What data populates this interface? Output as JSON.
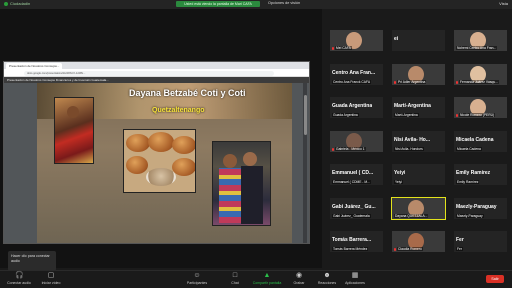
{
  "topbar": {
    "app_name": "Ciudadadin",
    "share_banner": "Usted está viendo la pantalla de Mari CAFA",
    "view_options": "Opciones de visión",
    "view_button": "Vista"
  },
  "browser": {
    "tab_title": "Presentación de Nosotros Concejos...",
    "url": "docs.google.com/presentation/d/e/2PACX-1vR8x...",
    "doc_title": "Presentación de Nosotros Consejos Financieros y de Inversión Guatemala..."
  },
  "slide": {
    "title": "Dayana Betzabé Coti y Coti",
    "city": "Quetzaltenango"
  },
  "popup": {
    "text": "Hacer clic para conectar audio"
  },
  "gallery": {
    "tiles": [
      {
        "label": "Mel CAFA",
        "type": "photo",
        "mic": true
      },
      {
        "label": "",
        "big": "ei",
        "type": "name"
      },
      {
        "label": "Nohemi Centro Ana Fran...",
        "type": "photo",
        "mic": false
      },
      {
        "big": "Centro Ana Fran...",
        "label": "Centro Ana Franck CAFA",
        "type": "name"
      },
      {
        "label": "Pri Adler Argentina",
        "type": "photo",
        "mic": true
      },
      {
        "label": "Fernanda Juárez Vásqu...",
        "type": "photo",
        "mic": true
      },
      {
        "big": "Guada Argentina",
        "label": "Guada Argentina",
        "type": "name"
      },
      {
        "big": "Martí-Argentina",
        "label": "Martí-Argentina",
        "type": "name"
      },
      {
        "label": "Nicole Romero (PERÚ)",
        "type": "photo",
        "mic": true
      },
      {
        "label": "Gabriela - México 1",
        "type": "photo",
        "mic": true
      },
      {
        "big": "Nisi Avila- Ho...",
        "label": "Nisi Avila- Hondurs",
        "type": "name"
      },
      {
        "big": "Micaela Cadena",
        "label": "Micaela Cadena",
        "type": "name"
      },
      {
        "big": "Emmanuel ( CD...",
        "label": "Emmanuel ( CDME - M...",
        "type": "name"
      },
      {
        "big": "Yeiyi",
        "label": "Yeiyi",
        "type": "name"
      },
      {
        "big": "Emily Ramírez",
        "label": "Emily Ramírez",
        "type": "name"
      },
      {
        "big": "Gabi Juárez_ Gu...",
        "label": "Gabi Juárez_ Guatemala",
        "type": "name"
      },
      {
        "label": "Dayana QUETZALA...",
        "type": "photo",
        "mic": false,
        "active": true
      },
      {
        "big": "Maezly-Paraguay",
        "label": "Maezly-Paraguay",
        "type": "name"
      },
      {
        "big": "Tomás Barrera...",
        "label": "Tomás Barrera Méndez",
        "type": "name"
      },
      {
        "label": "Claudia Romero",
        "type": "photo",
        "mic": true
      },
      {
        "big": "Fer",
        "label": "Fer",
        "type": "name"
      }
    ]
  },
  "toolbar": {
    "audio": "Conectar audio",
    "video": "Iniciar vídeo",
    "participants": "Participantes",
    "participants_count": "21",
    "chat": "Chat",
    "share": "Compartir pantalla",
    "record": "Grabar",
    "reactions": "Reacciones",
    "apps": "Aplicaciones",
    "leave": "Salir"
  },
  "colors": {
    "share_green": "#2bbf4a",
    "leave_red": "#d93025",
    "slide_title_yellow": "#f6e13a",
    "active_outline": "#e3e31c"
  }
}
